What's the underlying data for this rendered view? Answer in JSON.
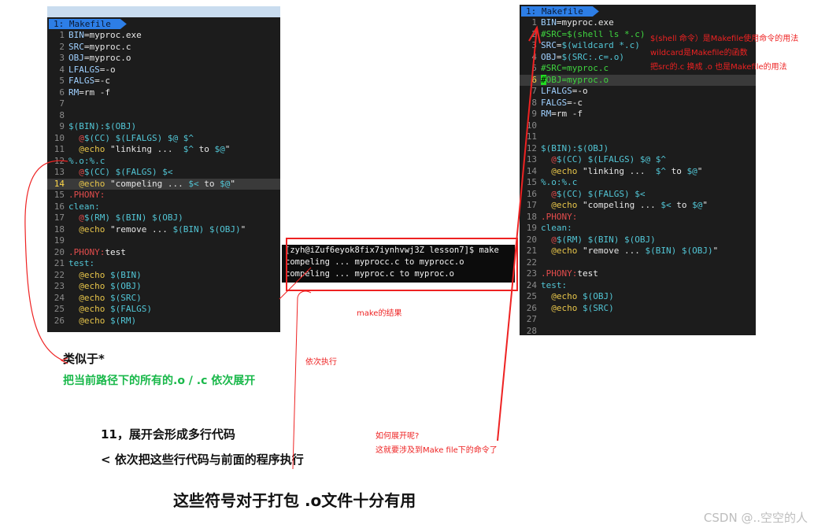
{
  "left_editor": {
    "tab_label": "1: Makefile",
    "lines": [
      {
        "n": "1",
        "segs": [
          [
            "var",
            "BIN"
          ],
          [
            "str",
            "=myproc.exe"
          ]
        ]
      },
      {
        "n": "2",
        "segs": [
          [
            "var",
            "SRC"
          ],
          [
            "str",
            "=myproc.c"
          ]
        ]
      },
      {
        "n": "3",
        "segs": [
          [
            "var",
            "OBJ"
          ],
          [
            "str",
            "=myproc.o"
          ]
        ]
      },
      {
        "n": "4",
        "segs": [
          [
            "var",
            "LFALGS"
          ],
          [
            "str",
            "=-o"
          ]
        ]
      },
      {
        "n": "5",
        "segs": [
          [
            "var",
            "FALGS"
          ],
          [
            "str",
            "=-c"
          ]
        ]
      },
      {
        "n": "6",
        "segs": [
          [
            "var",
            "RM"
          ],
          [
            "str",
            "=rm -f"
          ]
        ]
      },
      {
        "n": "7",
        "segs": []
      },
      {
        "n": "8",
        "segs": []
      },
      {
        "n": "9",
        "segs": [
          [
            "cyan",
            "$(BIN):$(OBJ)"
          ]
        ]
      },
      {
        "n": "10",
        "segs": [
          [
            "str",
            "  "
          ],
          [
            "red",
            "@"
          ],
          [
            "cyan",
            "$(CC) $(LFALGS) $@ $^"
          ]
        ]
      },
      {
        "n": "11",
        "segs": [
          [
            "str",
            "  "
          ],
          [
            "kw",
            "@echo"
          ],
          [
            "str",
            " \"linking ...  "
          ],
          [
            "cyan",
            "$^"
          ],
          [
            "str",
            " to "
          ],
          [
            "cyan",
            "$@"
          ],
          [
            "str",
            "\""
          ]
        ]
      },
      {
        "n": "12",
        "segs": [
          [
            "cyan",
            "%.o:%.c"
          ]
        ]
      },
      {
        "n": "13",
        "segs": [
          [
            "str",
            "  "
          ],
          [
            "red",
            "@"
          ],
          [
            "cyan",
            "$(CC) $(FALGS) $<"
          ]
        ]
      },
      {
        "n": "14",
        "cur": true,
        "segs": [
          [
            "str",
            "  "
          ],
          [
            "kw",
            "@echo"
          ],
          [
            "str",
            " \"compeling ... "
          ],
          [
            "cyan",
            "$<"
          ],
          [
            "str",
            " to "
          ],
          [
            "cyan",
            "$@"
          ],
          [
            "str",
            "\""
          ]
        ]
      },
      {
        "n": "15",
        "segs": [
          [
            "red",
            ".PHONY:"
          ]
        ]
      },
      {
        "n": "16",
        "segs": [
          [
            "cyan",
            "clean:"
          ]
        ]
      },
      {
        "n": "17",
        "segs": [
          [
            "str",
            "  "
          ],
          [
            "red",
            "@"
          ],
          [
            "cyan",
            "$(RM) $(BIN) $(OBJ)"
          ]
        ]
      },
      {
        "n": "18",
        "segs": [
          [
            "str",
            "  "
          ],
          [
            "kw",
            "@echo"
          ],
          [
            "str",
            " \"remove ... "
          ],
          [
            "cyan",
            "$(BIN) $(OBJ)"
          ],
          [
            "str",
            "\""
          ]
        ]
      },
      {
        "n": "19",
        "segs": []
      },
      {
        "n": "20",
        "segs": [
          [
            "red",
            ".PHONY:"
          ],
          [
            "white",
            "test"
          ]
        ]
      },
      {
        "n": "21",
        "segs": [
          [
            "cyan",
            "test:"
          ]
        ]
      },
      {
        "n": "22",
        "segs": [
          [
            "str",
            "  "
          ],
          [
            "kw",
            "@echo"
          ],
          [
            "str",
            " "
          ],
          [
            "cyan",
            "$(BIN)"
          ]
        ]
      },
      {
        "n": "23",
        "segs": [
          [
            "str",
            "  "
          ],
          [
            "kw",
            "@echo"
          ],
          [
            "str",
            " "
          ],
          [
            "cyan",
            "$(OBJ)"
          ]
        ]
      },
      {
        "n": "24",
        "segs": [
          [
            "str",
            "  "
          ],
          [
            "kw",
            "@echo"
          ],
          [
            "str",
            " "
          ],
          [
            "cyan",
            "$(SRC)"
          ]
        ]
      },
      {
        "n": "25",
        "segs": [
          [
            "str",
            "  "
          ],
          [
            "kw",
            "@echo"
          ],
          [
            "str",
            " "
          ],
          [
            "cyan",
            "$(FALGS)"
          ]
        ]
      },
      {
        "n": "26",
        "segs": [
          [
            "str",
            "  "
          ],
          [
            "kw",
            "@echo"
          ],
          [
            "str",
            " "
          ],
          [
            "cyan",
            "$(RM)"
          ]
        ]
      }
    ]
  },
  "right_editor": {
    "tab_label": "1: Makefile",
    "lines": [
      {
        "n": "1",
        "segs": [
          [
            "var",
            "BIN"
          ],
          [
            "str",
            "=myproc.exe"
          ]
        ]
      },
      {
        "n": "2",
        "segs": [
          [
            "cmt",
            "#SRC=$(shell ls *.c)"
          ]
        ]
      },
      {
        "n": "3",
        "segs": [
          [
            "var",
            "SRC"
          ],
          [
            "str",
            "="
          ],
          [
            "cyan",
            "$(wildcard *.c)"
          ]
        ]
      },
      {
        "n": "4",
        "segs": [
          [
            "var",
            "OBJ"
          ],
          [
            "str",
            "="
          ],
          [
            "cyan",
            "$(SRC:.c=.o)"
          ]
        ]
      },
      {
        "n": "5",
        "segs": [
          [
            "cmt",
            "#SRC=myproc.c"
          ]
        ]
      },
      {
        "n": "6",
        "cur": true,
        "segs": [
          [
            "mark",
            "#"
          ],
          [
            "cmt",
            "OBJ=myproc.o"
          ]
        ]
      },
      {
        "n": "7",
        "segs": [
          [
            "var",
            "LFALGS"
          ],
          [
            "str",
            "=-o"
          ]
        ]
      },
      {
        "n": "8",
        "segs": [
          [
            "var",
            "FALGS"
          ],
          [
            "str",
            "=-c"
          ]
        ]
      },
      {
        "n": "9",
        "segs": [
          [
            "var",
            "RM"
          ],
          [
            "str",
            "=rm -f"
          ]
        ]
      },
      {
        "n": "10",
        "segs": []
      },
      {
        "n": "11",
        "segs": []
      },
      {
        "n": "12",
        "segs": [
          [
            "cyan",
            "$(BIN):$(OBJ)"
          ]
        ]
      },
      {
        "n": "13",
        "segs": [
          [
            "str",
            "  "
          ],
          [
            "red",
            "@"
          ],
          [
            "cyan",
            "$(CC) $(LFALGS) $@ $^"
          ]
        ]
      },
      {
        "n": "14",
        "segs": [
          [
            "str",
            "  "
          ],
          [
            "kw",
            "@echo"
          ],
          [
            "str",
            " \"linking ...  "
          ],
          [
            "cyan",
            "$^"
          ],
          [
            "str",
            " to "
          ],
          [
            "cyan",
            "$@"
          ],
          [
            "str",
            "\""
          ]
        ]
      },
      {
        "n": "15",
        "segs": [
          [
            "cyan",
            "%.o:%.c"
          ]
        ]
      },
      {
        "n": "16",
        "segs": [
          [
            "str",
            "  "
          ],
          [
            "red",
            "@"
          ],
          [
            "cyan",
            "$(CC) $(FALGS) $<"
          ]
        ]
      },
      {
        "n": "17",
        "segs": [
          [
            "str",
            "  "
          ],
          [
            "kw",
            "@echo"
          ],
          [
            "str",
            " \"compeling ... "
          ],
          [
            "cyan",
            "$<"
          ],
          [
            "str",
            " to "
          ],
          [
            "cyan",
            "$@"
          ],
          [
            "str",
            "\""
          ]
        ]
      },
      {
        "n": "18",
        "segs": [
          [
            "red",
            ".PHONY:"
          ]
        ]
      },
      {
        "n": "19",
        "segs": [
          [
            "cyan",
            "clean:"
          ]
        ]
      },
      {
        "n": "20",
        "segs": [
          [
            "str",
            "  "
          ],
          [
            "red",
            "@"
          ],
          [
            "cyan",
            "$(RM) $(BIN) $(OBJ)"
          ]
        ]
      },
      {
        "n": "21",
        "segs": [
          [
            "str",
            "  "
          ],
          [
            "kw",
            "@echo"
          ],
          [
            "str",
            " \"remove ... "
          ],
          [
            "cyan",
            "$(BIN) $(OBJ)"
          ],
          [
            "str",
            "\""
          ]
        ]
      },
      {
        "n": "22",
        "segs": []
      },
      {
        "n": "23",
        "segs": [
          [
            "red",
            ".PHONY:"
          ],
          [
            "white",
            "test"
          ]
        ]
      },
      {
        "n": "24",
        "segs": [
          [
            "cyan",
            "test:"
          ]
        ]
      },
      {
        "n": "25",
        "segs": [
          [
            "str",
            "  "
          ],
          [
            "kw",
            "@echo"
          ],
          [
            "str",
            " "
          ],
          [
            "cyan",
            "$(OBJ)"
          ]
        ]
      },
      {
        "n": "26",
        "segs": [
          [
            "str",
            "  "
          ],
          [
            "kw",
            "@echo"
          ],
          [
            "str",
            " "
          ],
          [
            "cyan",
            "$(SRC)"
          ]
        ]
      },
      {
        "n": "27",
        "segs": []
      },
      {
        "n": "28",
        "segs": []
      }
    ]
  },
  "shell": {
    "lines": [
      "[zyh@iZuf6eyok8fix7iynhvwj3Z lesson7]$ make",
      "compeling ... myprocc.c to myprocc.o",
      "compeling ... myproc.c to myproc.o"
    ]
  },
  "notes": {
    "shell_note": "$(shell 命令）是Makefile使用命令的用法",
    "wildcard_note": "wildcard是Makefile的函数",
    "replace_note": "把src的.c 换成 .o 也是Makefile的用法",
    "make_result": "make的结果",
    "seq_exec": "依次执行",
    "how_expand": "如何展开呢?",
    "how_expand_2": "这就要涉及到Make file下的命令了",
    "similar": "类似于*",
    "expand_all": "把当前路径下的所有的.o / .c 依次展开",
    "line11": "11，展开会形成多行代码",
    "line_lt": "< 依次把这些行代码与前面的程序执行",
    "summary": "这些符号对于打包 .o文件十分有用",
    "watermark": "CSDN @..空空的人"
  },
  "colors": {
    "var": "#9fd0ff",
    "kw": "#e7c54a",
    "cyan": "#52c6d6",
    "red": "#e24c4c",
    "cmt": "#3fd43f",
    "green_text": "#19b84a",
    "annot_red": "#e22222"
  },
  "icons": [
    "tab-arrow-icon"
  ]
}
